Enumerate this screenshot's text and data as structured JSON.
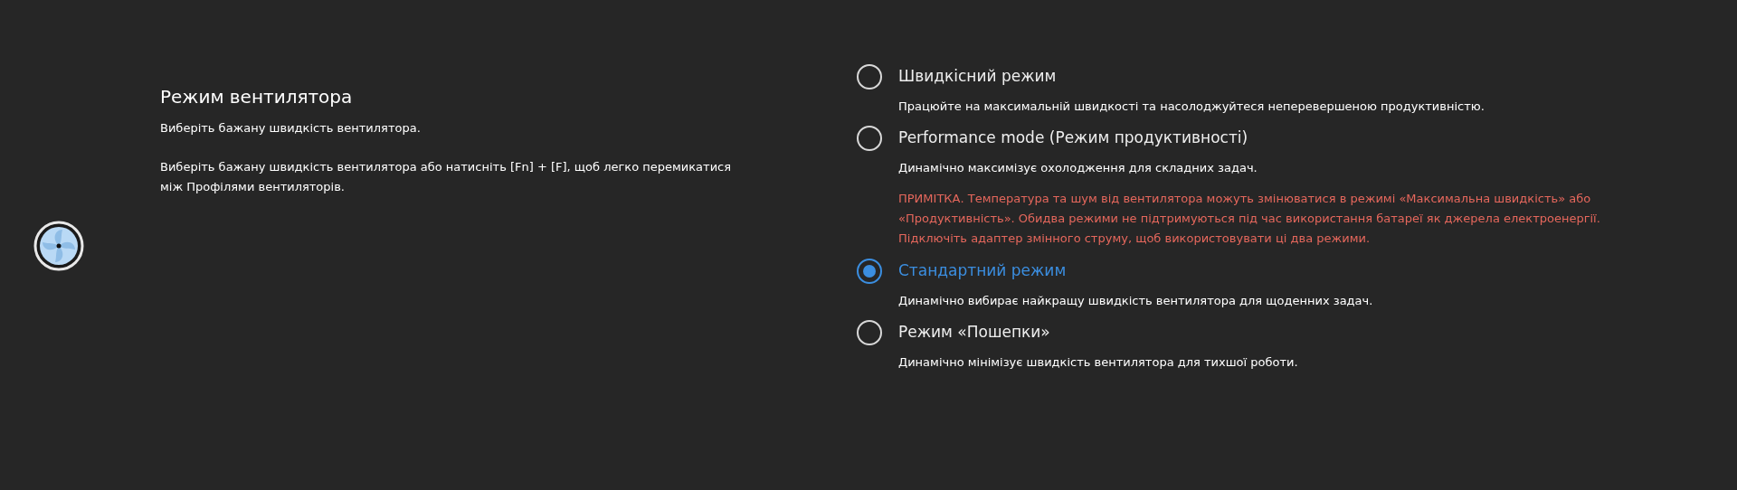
{
  "title": "Режим вентилятора",
  "subtitle": "Виберіть бажану швидкість вентилятора.",
  "hint": "Виберіть бажану швидкість вентилятора або натисніть [Fn] + [F], щоб легко перемикатися між Профілями вентиляторів.",
  "options": [
    {
      "label": "Швидкісний режим",
      "description": "Працюйте на максимальній швидкості та насолоджуйтеся неперевершеною продуктивністю.",
      "selected": false
    },
    {
      "label": "Performance mode (Режим продуктивності)",
      "description": "Динамічно максимізує охолодження для складних задач.",
      "note": "ПРИМІТКА. Температура та шум від вентилятора можуть змінюватися в режимі «Максимальна швидкість» або «Продуктивність». Обидва режими не підтримуються під час використання батареї як джерела електроенергії. Підключіть адаптер змінного струму, щоб використовувати ці два режими.",
      "selected": false
    },
    {
      "label": "Стандартний режим",
      "description": "Динамічно вибирає найкращу швидкість вентилятора для щоденних задач.",
      "selected": true
    },
    {
      "label": "Режим «Пошепки»",
      "description": "Динамічно мінімізує швидкість вентилятора для тихшої роботи.",
      "selected": false
    }
  ]
}
